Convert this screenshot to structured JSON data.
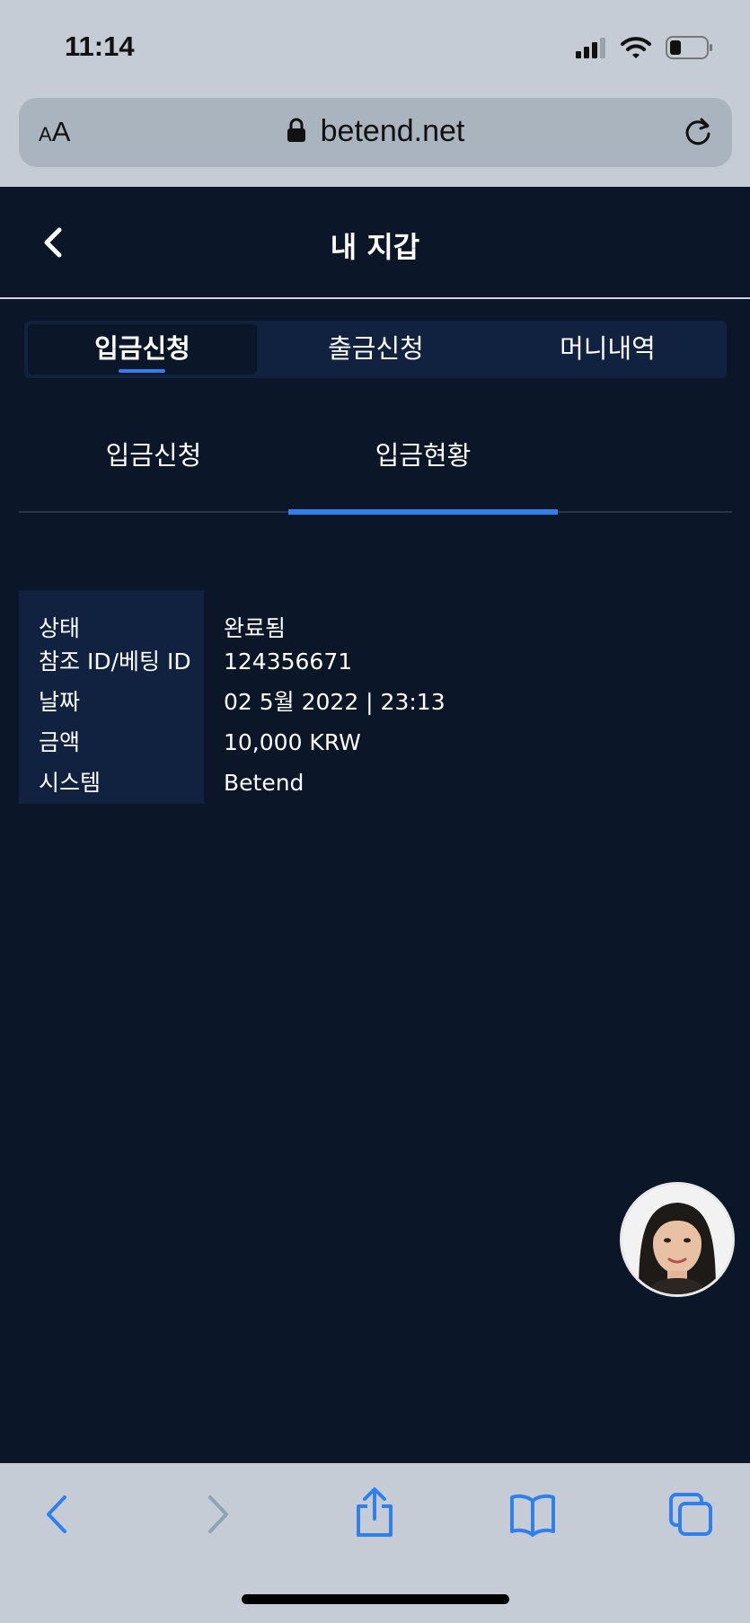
{
  "status_bar": {
    "time": "11:14"
  },
  "safari": {
    "text_size_label": "AA",
    "url": "betend.net"
  },
  "header": {
    "title": "내 지갑"
  },
  "tabs": [
    {
      "label": "입금신청",
      "active": true
    },
    {
      "label": "출금신청",
      "active": false
    },
    {
      "label": "머니내역",
      "active": false
    }
  ],
  "subtabs": [
    {
      "label": "입금신청",
      "active": false
    },
    {
      "label": "입금현황",
      "active": true
    }
  ],
  "detail": {
    "rows": [
      {
        "key": "상태",
        "value": "완료됨"
      },
      {
        "key": "참조 ID/베팅 ID",
        "value": "124356671"
      },
      {
        "key": "날짜",
        "value": "02 5월 2022 | 23:13"
      },
      {
        "key": "금액",
        "value": "10,000 KRW"
      },
      {
        "key": "시스템",
        "value": "Betend"
      }
    ]
  },
  "colors": {
    "background": "#0b1628",
    "panel": "#112240",
    "accent": "#2f80ed",
    "safari_chrome": "#c5ccd5",
    "toolbar_icon": "#2f80ed"
  },
  "icons": {
    "back": "chevron-left-icon",
    "lock": "lock-icon",
    "reload": "reload-icon",
    "share": "share-icon",
    "bookmarks": "book-icon",
    "tabs": "tabs-icon",
    "chat": "chat-avatar"
  }
}
